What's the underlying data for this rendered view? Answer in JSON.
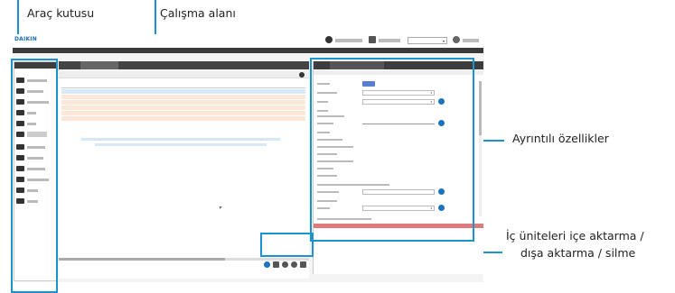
{
  "callouts": {
    "toolbox": "Araç kutusu",
    "workspace": "Çalışma alanı",
    "details": "Ayrıntılı özellikler",
    "units_line1": "İç üniteleri içe aktarma /",
    "units_line2": "dışa aktarma / silme"
  },
  "colors": {
    "accent": "#1b93d1",
    "dark_bar": "#3d3d3d",
    "highlight_row": "#d8e9f8",
    "warning_row": "#fde7d9",
    "status_red": "#e07a7a",
    "info_blue": "#1b72c0"
  },
  "icons": [
    "import-icon",
    "export-icon",
    "undo-icon",
    "settings-icon",
    "delete-icon",
    "info-icon",
    "chevron-down-icon",
    "user-icon"
  ]
}
